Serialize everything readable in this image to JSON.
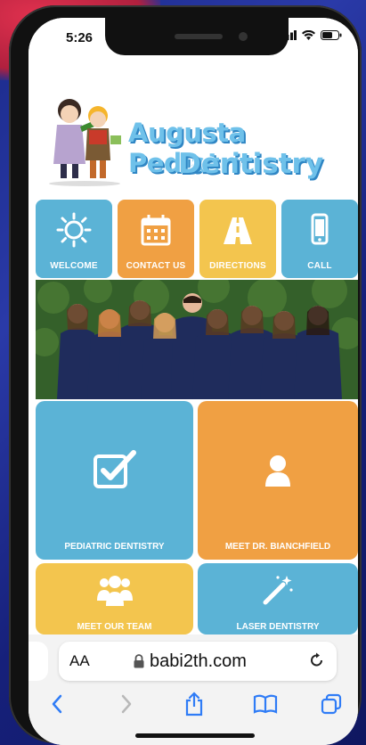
{
  "status": {
    "time": "5:26"
  },
  "brand": {
    "line1": "Augusta Pediatric",
    "line2": "Dentistry"
  },
  "nav_tiles": [
    {
      "label": "WELCOME",
      "icon": "sun-icon",
      "color": "#5bb3d6"
    },
    {
      "label": "CONTACT US",
      "icon": "calendar-icon",
      "color": "#f0a043"
    },
    {
      "label": "DIRECTIONS",
      "icon": "road-icon",
      "color": "#f3c54e"
    },
    {
      "label": "CALL",
      "icon": "phone-icon",
      "color": "#5bb3d6"
    }
  ],
  "feature_tiles": [
    {
      "label": "PEDIATRIC DENTISTRY",
      "icon": "checkbox-icon",
      "color": "#5bb3d6"
    },
    {
      "label": "MEET DR. BIANCHFIELD",
      "icon": "person-icon",
      "color": "#f0a043"
    },
    {
      "label": "MEET OUR TEAM",
      "icon": "group-icon",
      "color": "#f3c54e"
    },
    {
      "label": "LASER DENTISTRY",
      "icon": "magic-wand-icon",
      "color": "#5bb3d6"
    }
  ],
  "browser": {
    "aa_label": "AA",
    "url": "babi2th.com"
  }
}
